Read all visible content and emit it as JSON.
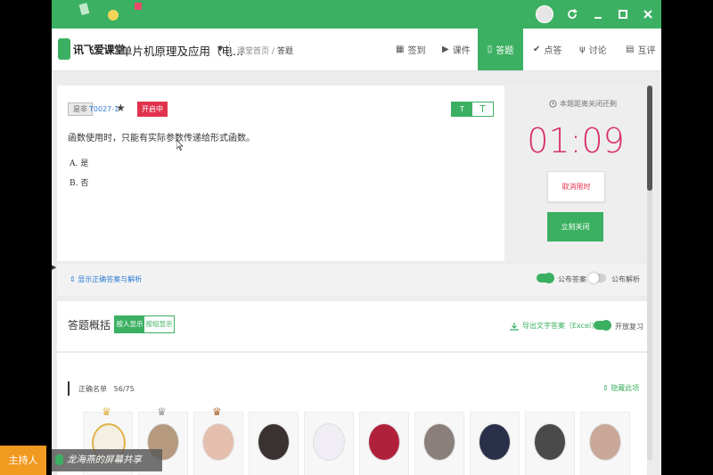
{
  "nav": {
    "logo": "讯飞爱课堂",
    "course": "单片机原理及应用（电...",
    "breadcrumb_home": "课堂首页",
    "breadcrumb_sep": "/",
    "breadcrumb_current": "答题",
    "items": [
      {
        "icon": "calendar-icon",
        "label": "签到"
      },
      {
        "icon": "play-icon",
        "label": "课件"
      },
      {
        "icon": "answer-icon",
        "label": "答题"
      },
      {
        "icon": "check-circle-icon",
        "label": "点答"
      },
      {
        "icon": "discussion-icon",
        "label": "讨论"
      },
      {
        "icon": "review-icon",
        "label": "互评"
      }
    ],
    "active_index": 2
  },
  "question": {
    "type_tag": "是非",
    "code": "T0027-1",
    "status": "开启中",
    "toggle_on": "T",
    "toggle_off": "T",
    "text": "函数使用时，只能有实际参数传递给形式函数。",
    "options": [
      "A. 是",
      "B. 否"
    ]
  },
  "timer": {
    "label": "本题距离关闭还剩",
    "time": "01:09",
    "cancel_label": "取消限时",
    "close_label": "立刻关闭"
  },
  "answer_bar": {
    "show_analysis": "显示正确答案与解析",
    "publish_answer": "公布答案",
    "publish_analysis": "公布解析"
  },
  "overview": {
    "title": "答题概括",
    "seg_on": "按人显示",
    "seg_off": "按组显示",
    "export": "导出文字答案（Excel）",
    "review": "开放复习"
  },
  "roster": {
    "label": "正确名单",
    "count": "56/75",
    "collapse": "隐藏此项"
  },
  "overlay": {
    "host": "主持人",
    "share": "龙海燕的屏幕共享"
  },
  "colors": {
    "accent": "#3cb062",
    "danger": "#e0334d",
    "timer": "#d6306a",
    "link": "#2f7fd6"
  }
}
